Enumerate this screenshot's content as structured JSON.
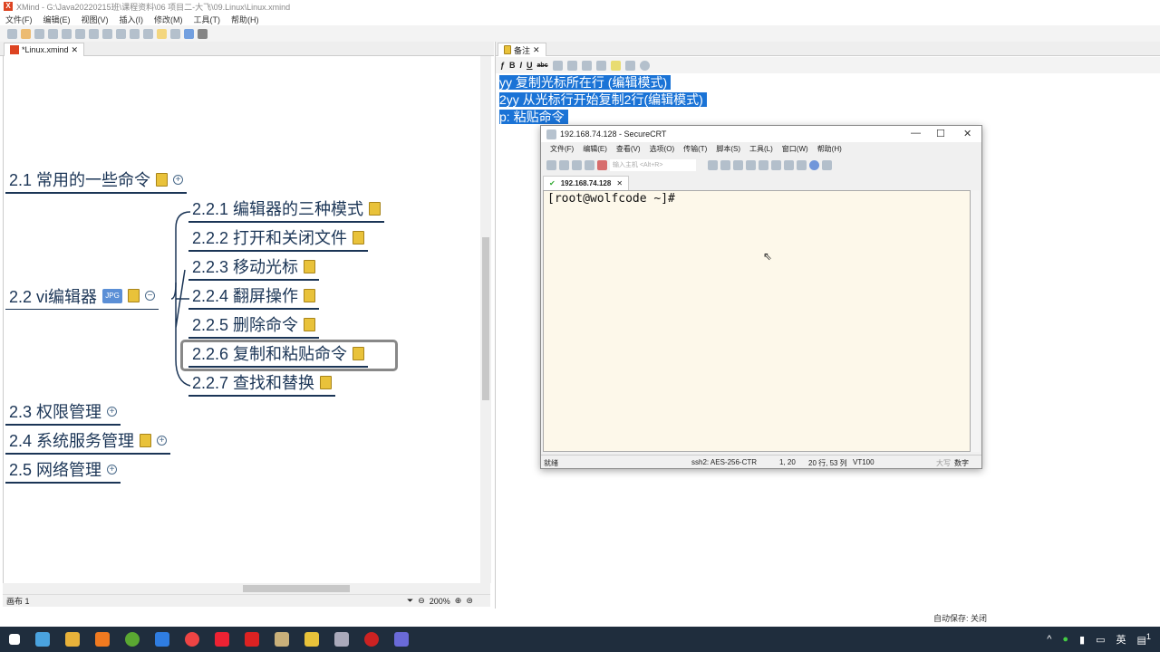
{
  "window": {
    "title": "XMind - G:\\Java20220215班\\课程资料\\06 项目二-大飞\\09.Linux\\Linux.xmind",
    "app": "X"
  },
  "menu": [
    "文件(F)",
    "编辑(E)",
    "视图(V)",
    "插入(I)",
    "修改(M)",
    "工具(T)",
    "帮助(H)"
  ],
  "editor_tab": "*Linux.xmind",
  "mindmap": {
    "topics": [
      {
        "label": "2.1 常用的一些命令",
        "note": true,
        "toggle": "+"
      },
      {
        "label": "2.2 vi编辑器",
        "note": true,
        "toggle": "−",
        "image": "JPG"
      },
      {
        "label": "2.3 权限管理",
        "toggle": "+"
      },
      {
        "label": "2.4 系统服务管理",
        "note": true,
        "toggle": "+"
      },
      {
        "label": "2.5 网络管理",
        "toggle": "+"
      }
    ],
    "subtopics": [
      "2.2.1 编辑器的三种模式",
      "2.2.2 打开和关闭文件",
      "2.2.3 移动光标",
      "2.2.4 翻屏操作",
      "2.2.5 删除命令",
      "2.2.6 复制和粘贴命令",
      "2.2.7 查找和替换"
    ],
    "selected": "2.2.6 复制和粘贴命令"
  },
  "status": {
    "sheet": "画布 1",
    "zoom": "200%",
    "autosave": "自动保存: 关闭"
  },
  "notes": {
    "tab": "备注",
    "toolbar": [
      "ƒ",
      "B",
      "I",
      "U",
      "abc"
    ],
    "lines": [
      "yy 复制光标所在行 (编辑模式)",
      "2yy 从光标行开始复制2行(编辑模式)",
      "p: 粘贴命令"
    ]
  },
  "securecrt": {
    "title": "192.168.74.128 - SecureCRT",
    "menu": [
      "文件(F)",
      "编辑(E)",
      "查看(V)",
      "选项(O)",
      "传输(T)",
      "脚本(S)",
      "工具(L)",
      "窗口(W)",
      "帮助(H)"
    ],
    "host_placeholder": "输入主机 <Alt+R>",
    "tab": "192.168.74.128",
    "prompt": "[root@wolfcode ~]#",
    "status": {
      "ready": "就绪",
      "cipher": "ssh2: AES-256-CTR",
      "pos": "1,  20",
      "size": "20 行, 53 列",
      "term": "VT100",
      "caps": "大写",
      "num": "数字"
    }
  },
  "taskbar": {
    "apps": [
      "windows-start",
      "app-store",
      "file-explorer",
      "notes",
      "frog",
      "meeting",
      "chrome",
      "xmind",
      "wps",
      "paint",
      "files",
      "securecrt",
      "record",
      "photos"
    ],
    "tray_lang": "英",
    "notif_count": "1"
  },
  "colors": {
    "topic": "#1b3556",
    "highlight": "#1a73d6",
    "note_icon": "#e9c23a",
    "terminal_bg": "#fdf8ea",
    "taskbar": "#1f2d3d"
  }
}
